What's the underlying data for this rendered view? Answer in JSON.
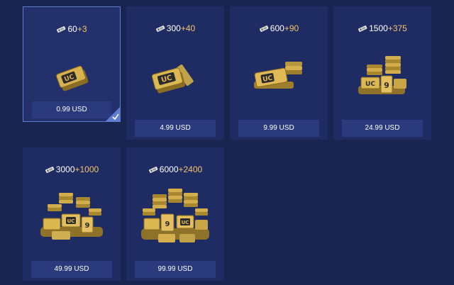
{
  "packages": [
    {
      "base": "60",
      "bonus": "+3",
      "price": "0.99 USD",
      "selected": true
    },
    {
      "base": "300",
      "bonus": "+40",
      "price": "4.99 USD",
      "selected": false
    },
    {
      "base": "600",
      "bonus": "+90",
      "price": "9.99 USD",
      "selected": false
    },
    {
      "base": "1500",
      "bonus": "+375",
      "price": "24.99 USD",
      "selected": false
    },
    {
      "base": "3000",
      "bonus": "+1000",
      "price": "49.99 USD",
      "selected": false
    },
    {
      "base": "6000",
      "bonus": "+2400",
      "price": "99.99 USD",
      "selected": false
    }
  ],
  "icons": {
    "currency": "uc-ticket-icon",
    "selected": "checkmark-icon"
  },
  "colors": {
    "background": "#1a2450",
    "card": "#1f2c63",
    "price_bar": "#2a3a7c",
    "bonus": "#f2c46a",
    "selected_border": "#5d7ed0",
    "gold": "#c9a544"
  }
}
